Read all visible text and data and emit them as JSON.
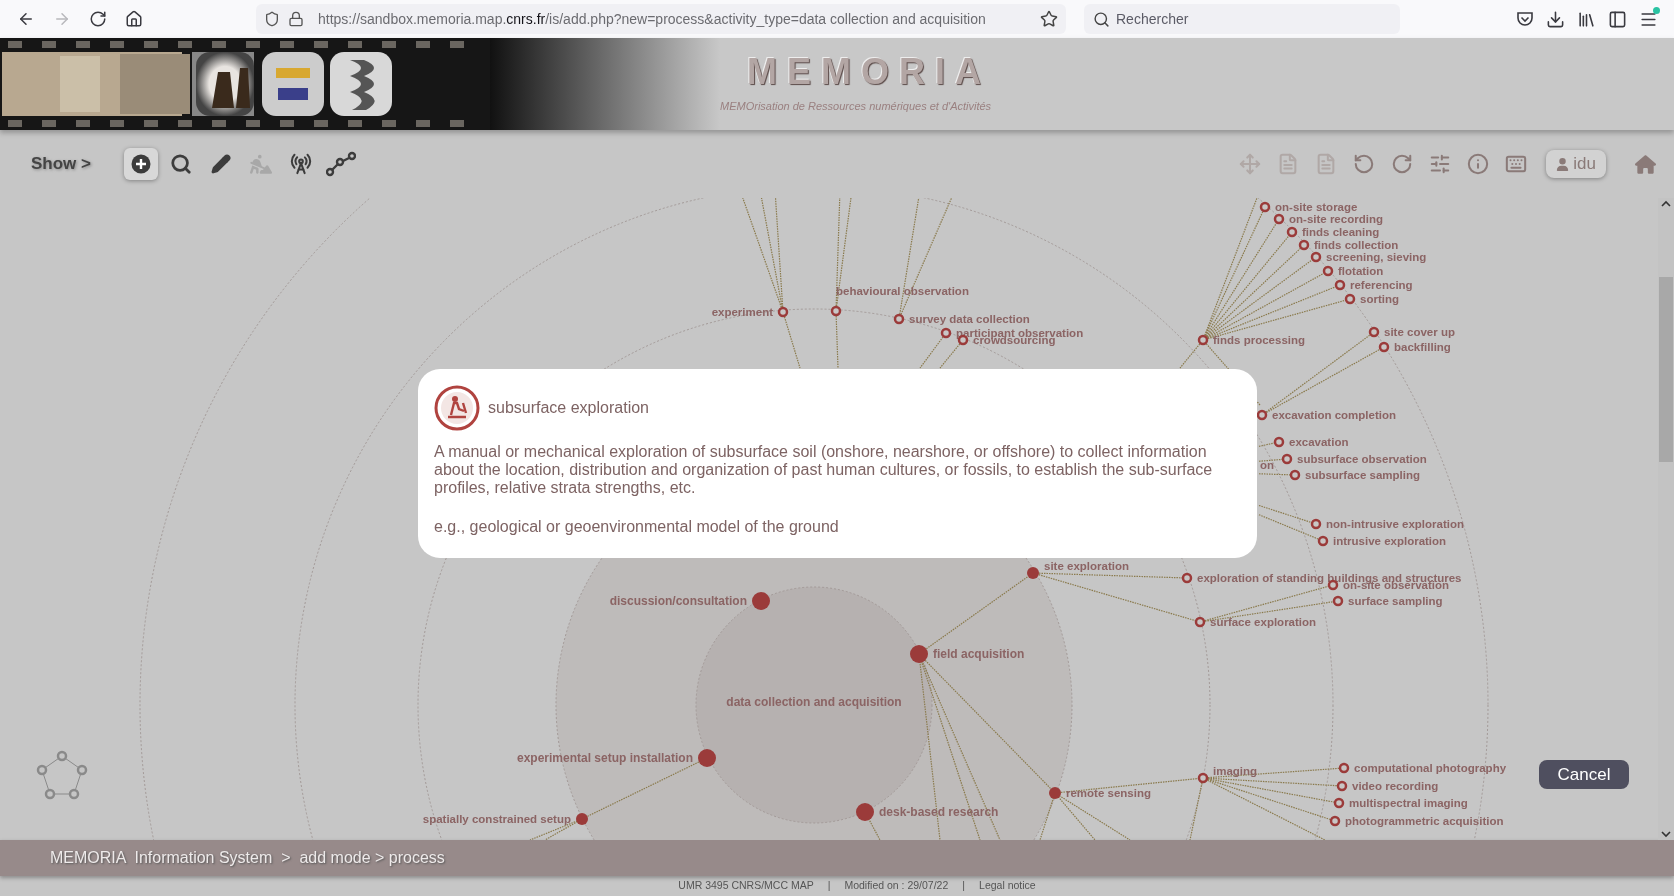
{
  "browser": {
    "nav": [
      {
        "disabled": false
      },
      {
        "disabled": true
      },
      {
        "disabled": false
      },
      {
        "disabled": false
      }
    ],
    "url": {
      "before": "https://sandbox.memoria.map.",
      "domain": "cnrs.fr",
      "after": "/is/add.php?new=process&activity_type=data collection and acquisition"
    },
    "search": {
      "placeholder": "Rechercher"
    },
    "menu_notification": true
  },
  "header": {
    "title": "MEMORIA",
    "subtitle": "MEMOrisation de Ressources numériques et d'Activités"
  },
  "toolbar": {
    "show_label": "Show >",
    "left_tools": [
      {
        "selected": true,
        "disabled": false
      },
      {
        "selected": false,
        "disabled": false
      },
      {
        "selected": false,
        "disabled": false
      },
      {
        "selected": false,
        "disabled": true
      },
      {
        "selected": false,
        "disabled": false
      },
      {
        "selected": false,
        "disabled": false
      }
    ],
    "right_tools": [
      {
        "disabled": true
      },
      {
        "disabled": true
      },
      {
        "disabled": true
      },
      {
        "disabled": false
      },
      {
        "disabled": false
      },
      {
        "disabled": false
      },
      {
        "disabled": false
      },
      {
        "disabled": false
      },
      {
        "disabled": false
      }
    ],
    "user": "idu"
  },
  "graph": {
    "center_label": "data collection and acquisition",
    "nodes": [
      {
        "label": "discussion/consultation",
        "kind": "major"
      },
      {
        "label": "field acquisition",
        "kind": "major"
      },
      {
        "label": "experimental setup installation",
        "kind": "major"
      },
      {
        "label": "desk-based research",
        "kind": "major"
      },
      {
        "label": "spatially constrained setup",
        "kind": "minor"
      },
      {
        "label": "site exploration",
        "kind": "minor"
      },
      {
        "label": "remote sensing",
        "kind": "minor"
      },
      {
        "label": "experiment",
        "kind": "ring"
      },
      {
        "label": "behavioural observation",
        "kind": "ring"
      },
      {
        "label": "survey data collection",
        "kind": "ring"
      },
      {
        "label": "participant observation",
        "kind": "ring"
      },
      {
        "label": "crowdsourcing",
        "kind": "ring"
      },
      {
        "label": "finds processing",
        "kind": "ring"
      },
      {
        "label": "on-site storage",
        "kind": "ring"
      },
      {
        "label": "on-site recording",
        "kind": "ring"
      },
      {
        "label": "finds cleaning",
        "kind": "ring"
      },
      {
        "label": "finds collection",
        "kind": "ring"
      },
      {
        "label": "screening, sieving",
        "kind": "ring"
      },
      {
        "label": "flotation",
        "kind": "ring"
      },
      {
        "label": "referencing",
        "kind": "ring"
      },
      {
        "label": "sorting",
        "kind": "ring"
      },
      {
        "label": "site cover up",
        "kind": "ring"
      },
      {
        "label": "backfilling",
        "kind": "ring"
      },
      {
        "label": "excavation completion",
        "kind": "ring"
      },
      {
        "label": "excavation",
        "kind": "ring"
      },
      {
        "label": "subsurface observation",
        "kind": "ring"
      },
      {
        "label": "subsurface sampling",
        "kind": "ring"
      },
      {
        "label": "non-intrusive exploration",
        "kind": "ring"
      },
      {
        "label": "intrusive exploration",
        "kind": "ring"
      },
      {
        "label": "exploration of standing buildings and structures",
        "kind": "ring"
      },
      {
        "label": "on-site observation",
        "kind": "ring"
      },
      {
        "label": "surface exploration",
        "kind": "ring"
      },
      {
        "label": "surface sampling",
        "kind": "ring"
      },
      {
        "label": "imaging",
        "kind": "ring"
      },
      {
        "label": "computational photography",
        "kind": "ring"
      },
      {
        "label": "video recording",
        "kind": "ring"
      },
      {
        "label": "multispectral imaging",
        "kind": "ring"
      },
      {
        "label": "photogrammetric acquisition",
        "kind": "ring"
      },
      {
        "label": "on",
        "kind": "fragment"
      }
    ]
  },
  "dialog": {
    "title": "subsurface exploration",
    "description": "A manual or mechanical exploration of subsurface soil (onshore, nearshore, or offshore) to collect information about the location, distribution and organization of past human cultures, or fossils, to establish the sub-surface profiles, relative strata strengths, etc.",
    "example": "e.g., geological or geoenvironmental model of the ground"
  },
  "cancel_button": "Cancel",
  "breadcrumb": "MEMORIA  Information System  >  add mode > process",
  "footer": [
    "UMR 3495 CNRS/MCC MAP",
    "|",
    "Modified on : 29/07/22",
    "|",
    "Legal notice"
  ]
}
